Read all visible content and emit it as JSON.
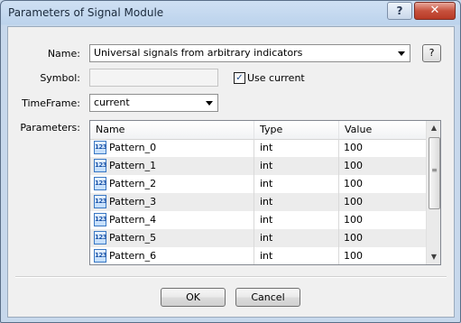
{
  "window": {
    "title": "Parameters of Signal Module",
    "help_button": "?",
    "close_button": "✕"
  },
  "form": {
    "name_label": "Name:",
    "name_value": "Universal signals from arbitrary indicators",
    "name_help": "?",
    "symbol_label": "Symbol:",
    "symbol_value": "",
    "use_current_label": "Use current",
    "use_current_checked": true,
    "timeframe_label": "TimeFrame:",
    "timeframe_value": "current",
    "parameters_label": "Parameters:"
  },
  "grid": {
    "columns": [
      "Name",
      "Type",
      "Value"
    ],
    "param_icon_text": "123",
    "rows": [
      {
        "name": "Pattern_0",
        "type": "int",
        "value": "100"
      },
      {
        "name": "Pattern_1",
        "type": "int",
        "value": "100"
      },
      {
        "name": "Pattern_2",
        "type": "int",
        "value": "100"
      },
      {
        "name": "Pattern_3",
        "type": "int",
        "value": "100"
      },
      {
        "name": "Pattern_4",
        "type": "int",
        "value": "100"
      },
      {
        "name": "Pattern_5",
        "type": "int",
        "value": "100"
      },
      {
        "name": "Pattern_6",
        "type": "int",
        "value": "100"
      }
    ]
  },
  "buttons": {
    "ok": "OK",
    "cancel": "Cancel"
  }
}
